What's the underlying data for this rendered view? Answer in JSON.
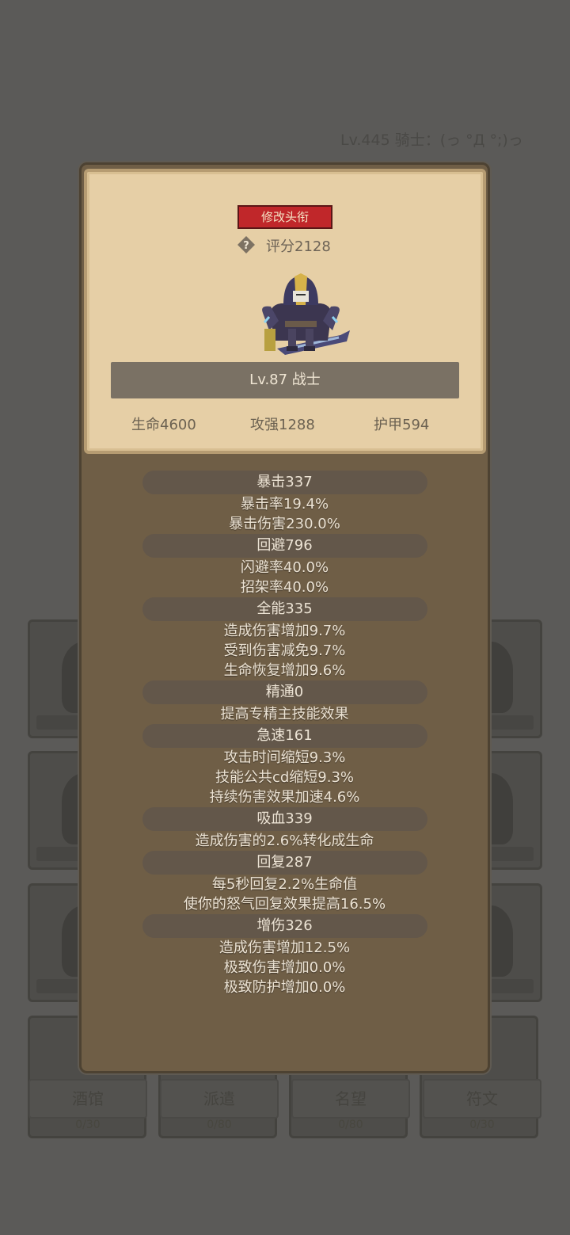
{
  "header": {
    "player_info": "Lv.445 骑士：(っ °Д °;)っ"
  },
  "background": {
    "tabs": [
      {
        "label": "酒馆",
        "count": "0/30"
      },
      {
        "label": "派遣",
        "count": "0/80"
      },
      {
        "label": "名望",
        "count": "0/80"
      },
      {
        "label": "符文",
        "count": "0/30"
      }
    ]
  },
  "card": {
    "title_button": "修改头衔",
    "help_icon": "question-icon",
    "score": "评分2128",
    "level_class": "Lv.87 战士",
    "hp": "生命4600",
    "attack": "攻强1288",
    "armor": "护甲594"
  },
  "stats": [
    {
      "header": "暴击337",
      "lines": [
        "暴击率19.4%",
        "暴击伤害230.0%"
      ]
    },
    {
      "header": "回避796",
      "lines": [
        "闪避率40.0%",
        "招架率40.0%"
      ]
    },
    {
      "header": "全能335",
      "lines": [
        "造成伤害增加9.7%",
        "受到伤害减免9.7%",
        "生命恢复增加9.6%"
      ]
    },
    {
      "header": "精通0",
      "lines": [
        "提高专精主技能效果"
      ]
    },
    {
      "header": "急速161",
      "lines": [
        "攻击时间缩短9.3%",
        "技能公共cd缩短9.3%",
        "持续伤害效果加速4.6%"
      ]
    },
    {
      "header": "吸血339",
      "lines": [
        "造成伤害的2.6%转化成生命"
      ]
    },
    {
      "header": "回复287",
      "lines": [
        "每5秒回复2.2%生命值",
        "使你的怒气回复效果提高16.5%"
      ]
    },
    {
      "header": "增伤326",
      "lines": [
        "造成伤害增加12.5%",
        "极致伤害增加0.0%",
        "极致防护增加0.0%"
      ]
    }
  ],
  "colors": {
    "button_red": "#c0272a",
    "parchment": "#e6cfa6",
    "panel_brown": "#6f5e46"
  }
}
